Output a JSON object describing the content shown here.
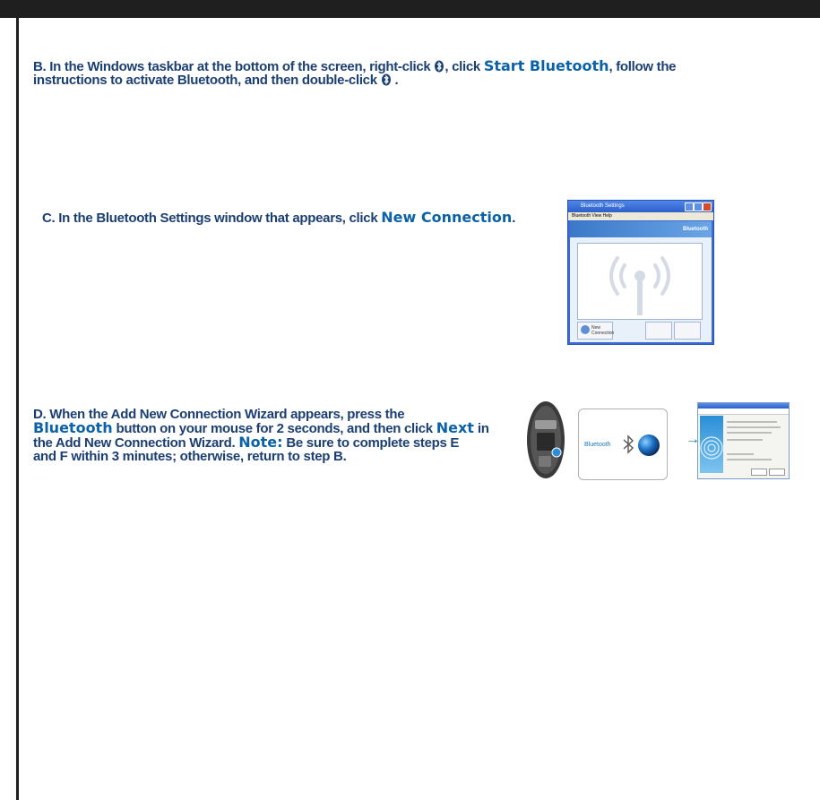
{
  "steps": {
    "b": {
      "line1_a": "B. In the Windows taskbar at the bottom of the screen, right-click",
      "line1_b": ", click",
      "line1_em": "Start Bluetooth",
      "line1_c": ", follow the",
      "line2_a": "instructions to activate Bluetooth, and then double-click",
      "line2_b": "."
    },
    "c": {
      "text_a": "C. In the Bluetooth Settings window that appears, click",
      "em": "New Connection",
      "text_b": "."
    },
    "d": {
      "line1": "D. When the Add New Connection Wizard appears, press the",
      "em1": "Bluetooth",
      "line2_a": "button on your mouse for 2 seconds, and then click",
      "em2": "Next",
      "line2_b": "in",
      "line3_a": "the Add New Connection Wizard.",
      "em3": "Note:",
      "line3_b": "Be sure to complete steps E",
      "line4": "and F within 3 minutes; otherwise, return to step B."
    }
  },
  "screenshot_c": {
    "title": "Bluetooth Settings",
    "menu": "Bluetooth   View   Help",
    "banner": "Bluetooth",
    "button": "New Connection"
  },
  "images_d": {
    "card_label": "Bluetooth"
  },
  "colors": {
    "text": "#1b3f73",
    "emphasis": "#0b62a8",
    "frame": "#1f1f1f"
  }
}
